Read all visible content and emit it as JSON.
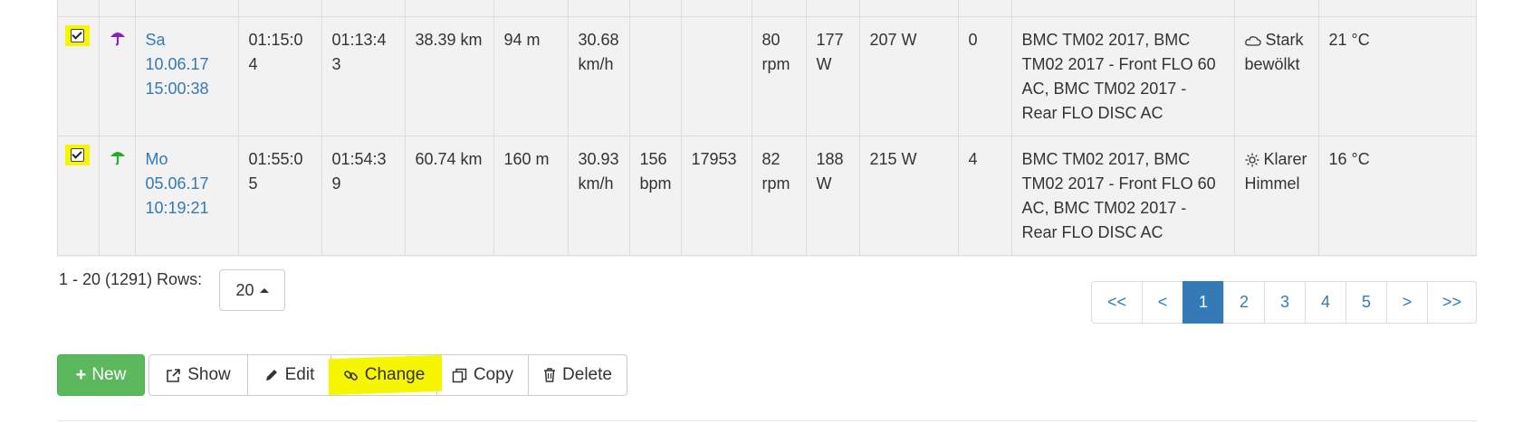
{
  "rows": [
    {
      "day": "Sa",
      "date": "10.06.17",
      "time": "15:00:38",
      "total_time": "01:15:04",
      "moving_time": "01:13:43",
      "distance": "38.39 km",
      "elevation": "94 m",
      "speed_value": "30.68",
      "speed_unit": "km/h",
      "heartrate_value": "",
      "heartrate_unit": "",
      "extra": "",
      "cadence_value": "80",
      "cadence_unit": "rpm",
      "power_value": "177",
      "power_unit": "W",
      "power_norm": "207 W",
      "count": "0",
      "equipment_lines": [
        "BMC TM02 2017, BMC",
        "TM02 2017 - Front FLO 60",
        "AC, BMC TM02 2017 -",
        "Rear FLO DISC AC"
      ],
      "weather_icon": "cloud-icon",
      "weather_line1": "Stark",
      "weather_line2": "bewölkt",
      "temperature": "21 °C",
      "umbrella_color": "#8b1fc4"
    },
    {
      "day": "Mo",
      "date": "05.06.17",
      "time": "10:19:21",
      "total_time": "01:55:05",
      "moving_time": "01:54:39",
      "distance": "60.74 km",
      "elevation": "160 m",
      "speed_value": "30.93",
      "speed_unit": "km/h",
      "heartrate_value": "156",
      "heartrate_unit": "bpm",
      "extra": "17953",
      "cadence_value": "82",
      "cadence_unit": "rpm",
      "power_value": "188",
      "power_unit": "W",
      "power_norm": "215 W",
      "count": "4",
      "equipment_lines": [
        "BMC TM02 2017, BMC",
        "TM02 2017 - Front FLO 60",
        "AC, BMC TM02 2017 -",
        "Rear FLO DISC AC"
      ],
      "weather_icon": "sun-icon",
      "weather_line1": "Klarer",
      "weather_line2": "Himmel",
      "temperature": "16 °C",
      "umbrella_color": "#1fae2a"
    }
  ],
  "footer": {
    "range_text": "1 - 20 (1291) Rows:",
    "rows_select_value": "20"
  },
  "pagination": {
    "first": "<<",
    "prev": "<",
    "pages": [
      "1",
      "2",
      "3",
      "4",
      "5"
    ],
    "active_page": "1",
    "next": ">",
    "last": ">>"
  },
  "actions": {
    "new_label": "New",
    "show_label": "Show",
    "edit_label": "Edit",
    "change_label": "Change",
    "copy_label": "Copy",
    "delete_label": "Delete"
  },
  "colors": {
    "highlight": "#f6f600",
    "link": "#337ab7",
    "new_button": "#5cb85c"
  }
}
